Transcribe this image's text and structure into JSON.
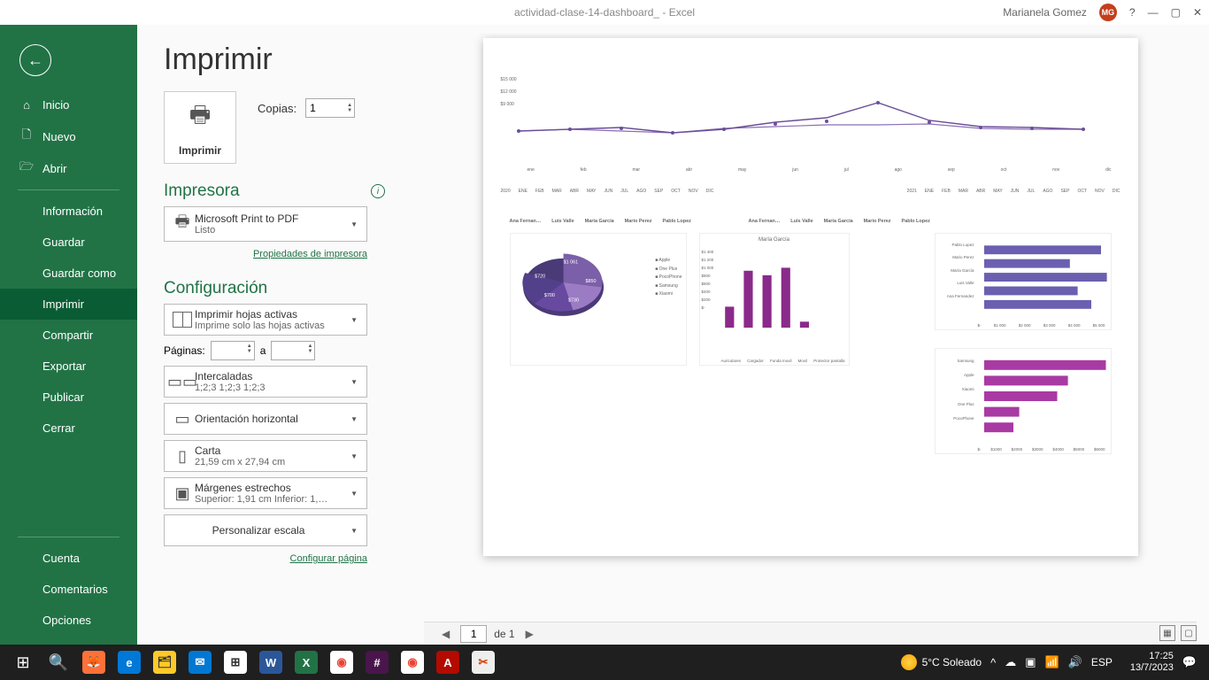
{
  "title_bar": {
    "doc_title": "actividad-clase-14-dashboard_ - Excel",
    "user_name": "Marianela Gomez",
    "user_initials": "MG"
  },
  "sidebar": {
    "home": "Inicio",
    "new": "Nuevo",
    "open": "Abrir",
    "items": [
      "Información",
      "Guardar",
      "Guardar como",
      "Imprimir",
      "Compartir",
      "Exportar",
      "Publicar",
      "Cerrar"
    ],
    "bottom": [
      "Cuenta",
      "Comentarios",
      "Opciones"
    ]
  },
  "print": {
    "title": "Imprimir",
    "print_btn": "Imprimir",
    "copies_label": "Copias:",
    "copies_value": "1",
    "printer_section": "Impresora",
    "printer_name": "Microsoft Print to PDF",
    "printer_status": "Listo",
    "printer_props": "Propiedades de impresora",
    "config_section": "Configuración",
    "scope_line1": "Imprimir hojas activas",
    "scope_line2": "Imprime solo las hojas activas",
    "pages_label": "Páginas:",
    "pages_sep": "a",
    "collate_line1": "Intercaladas",
    "collate_line2": "1;2;3    1;2;3    1;2;3",
    "orient": "Orientación horizontal",
    "paper_line1": "Carta",
    "paper_line2": "21,59 cm x 27,94 cm",
    "margin_line1": "Márgenes estrechos",
    "margin_line2": "Superior: 1,91 cm Inferior: 1,…",
    "scale": "Personalizar escala",
    "page_setup": "Configurar página"
  },
  "preview": {
    "page_input": "1",
    "page_total": "de 1",
    "line_legend": [
      "2020",
      "2021"
    ],
    "months": [
      "ene",
      "feb",
      "mar",
      "abr",
      "may",
      "jun",
      "jul",
      "ago",
      "sep",
      "oct",
      "nov",
      "dic"
    ],
    "year1": "2020",
    "year2": "2021",
    "people": [
      "Ana Fernan…",
      "Luis Valle",
      "María García",
      "Mario Perez",
      "Pablo Lopez"
    ],
    "bar_title": "María García",
    "bar_series_lbl": "María García",
    "pie_legend": [
      "Apple",
      "One Plus",
      "PocoPhone",
      "Samsung",
      "Xiaomi"
    ],
    "hbar1_cats": [
      "Pablo Lopez",
      "Mario Perez",
      "María García",
      "Luis Valle",
      "Ana Fernandez"
    ],
    "hbar2_cats": [
      "Samsung",
      "Apple",
      "Xiaomi",
      "One Plus",
      "PocoPhone"
    ],
    "bar_cats": [
      "Auriculares",
      "Cargador",
      "Funda movil",
      "Movil",
      "Protector pantalla"
    ],
    "y_ticks": [
      "$15 000",
      "$12 000",
      "$9 000"
    ],
    "y_ticks_bar": [
      "$1 400",
      "$1 200",
      "$1 000",
      "$800",
      "$600",
      "$400",
      "$200",
      "$-"
    ],
    "money_ticks": [
      "$-",
      "$1 000",
      "$2 000",
      "$3 000",
      "$4 000",
      "$5 000"
    ]
  },
  "taskbar": {
    "weather": "5°C  Soleado",
    "lang": "ESP",
    "time": "17:25",
    "date": "13/7/2023"
  },
  "chart_data": [
    {
      "type": "line",
      "title": "",
      "x": [
        "ene",
        "feb",
        "mar",
        "abr",
        "may",
        "jun",
        "jul",
        "ago",
        "sep",
        "oct",
        "nov",
        "dic"
      ],
      "series": [
        {
          "name": "2020",
          "values": [
            9000,
            9200,
            9000,
            8800,
            9400,
            9600,
            9800,
            9800,
            9900,
            9300,
            9200,
            9200
          ]
        },
        {
          "name": "2021",
          "values": [
            9000,
            9200,
            9500,
            8800,
            9200,
            10200,
            10800,
            12500,
            10500,
            9600,
            9400,
            9200
          ]
        }
      ],
      "ylim": [
        8000,
        15000
      ]
    },
    {
      "type": "pie",
      "categories": [
        "Apple",
        "One Plus",
        "PocoPhone",
        "Samsung",
        "Xiaomi"
      ],
      "values": [
        1061,
        850,
        700,
        720,
        730
      ]
    },
    {
      "type": "bar",
      "title": "María García",
      "categories": [
        "Auriculares",
        "Cargador",
        "Funda movil",
        "Movil",
        "Protector pantalla"
      ],
      "values": [
        450,
        1200,
        1100,
        1250,
        150
      ],
      "ylim": [
        0,
        1400
      ]
    },
    {
      "type": "bar",
      "orientation": "h",
      "categories": [
        "Pablo Lopez",
        "Mario Perez",
        "María García",
        "Luis Valle",
        "Ana Fernandez"
      ],
      "values": [
        4600,
        3400,
        4800,
        3700,
        4200
      ],
      "xlim": [
        0,
        5000
      ]
    },
    {
      "type": "bar",
      "orientation": "h",
      "categories": [
        "Samsung",
        "Apple",
        "Xiaomi",
        "One Plus",
        "PocoPhone"
      ],
      "values": [
        5800,
        4000,
        3500,
        1700,
        1400
      ],
      "xlim": [
        0,
        6000
      ]
    }
  ]
}
